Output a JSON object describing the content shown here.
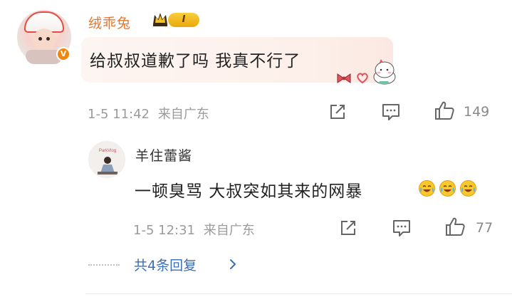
{
  "comment": {
    "username": "绒乖兔",
    "level_badge": "I",
    "text": "给叔叔道歉了吗 我真不行了",
    "timestamp": "1-5 11:42",
    "location": "来自广东",
    "like_count": "149",
    "verified_mark": "V"
  },
  "reply": {
    "username": "羊住蕾酱",
    "text": "一顿臭骂 大叔突如其来的网暴",
    "timestamp": "1-5 12:31",
    "location": "来自广东",
    "like_count": "77",
    "avatar_caption": "ParkVlog"
  },
  "more_replies_label": "共4条回复",
  "colors": {
    "username_orange": "#e8762a",
    "link_blue": "#3b6fb3",
    "meta_gray": "#9b9b9b",
    "verified_orange": "#f3850d",
    "badge_gold": "#f2bc22"
  },
  "icons": [
    "share-icon",
    "comment-icon",
    "like-icon",
    "chevron-right-icon",
    "laughing-crying-emoji",
    "crown-icon"
  ]
}
